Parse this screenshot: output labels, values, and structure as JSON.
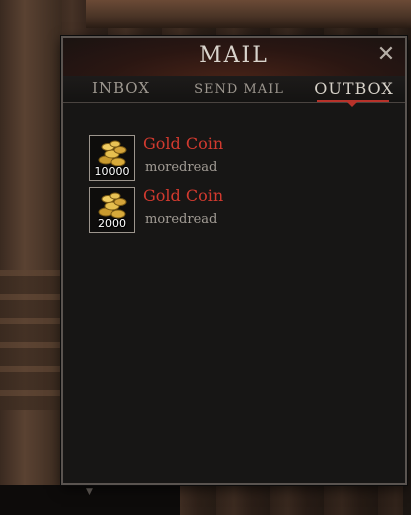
{
  "window": {
    "title": "MAIL",
    "close_icon": "close-icon"
  },
  "tabs": [
    {
      "label": "INBOX",
      "active": false
    },
    {
      "label": "SEND MAIL",
      "active": false
    },
    {
      "label": "OUTBOX",
      "active": true
    }
  ],
  "outbox": {
    "items": [
      {
        "item_name": "Gold Coin",
        "quantity": "10000",
        "sender": "moredread",
        "icon": "gold-coin-icon"
      },
      {
        "item_name": "Gold Coin",
        "quantity": "2000",
        "sender": "moredread",
        "icon": "gold-coin-icon"
      }
    ]
  },
  "colors": {
    "item_name": "#d23a2f",
    "active_tab_accent": "#b8322a",
    "window_bg": "#171615"
  }
}
